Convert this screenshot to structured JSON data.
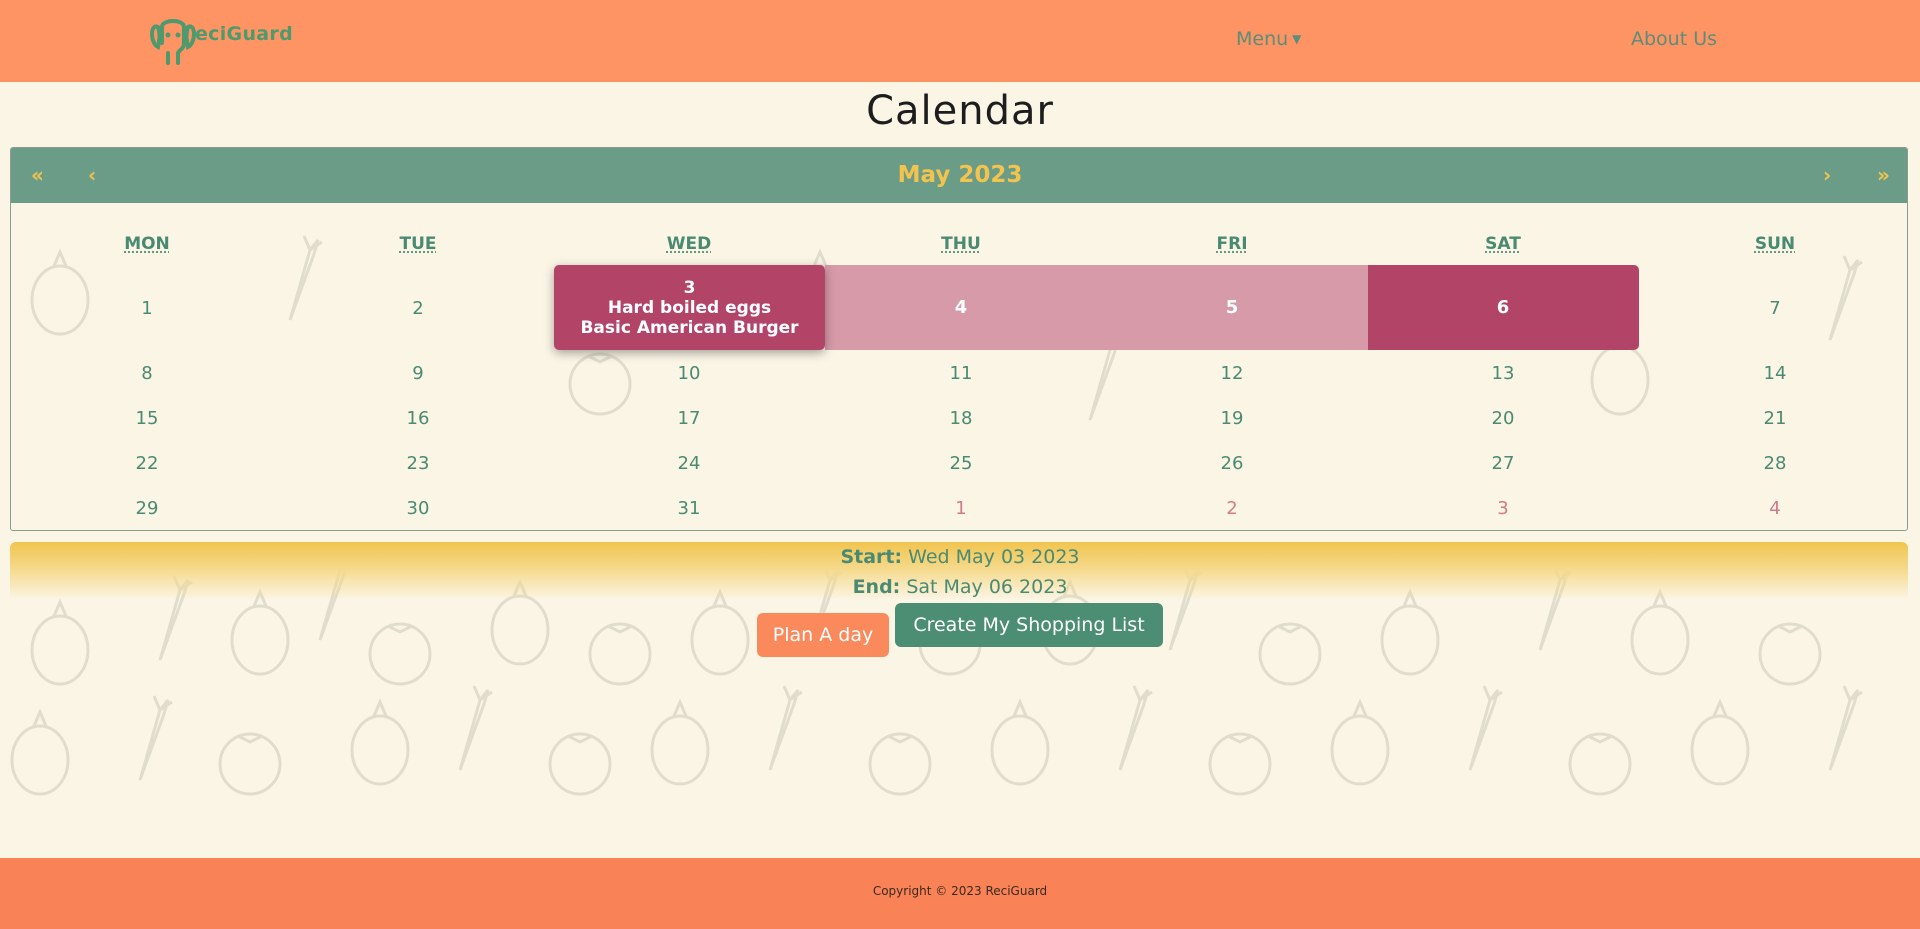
{
  "brand": {
    "name": "eciGuard",
    "logo_icon": "elephant-icon"
  },
  "nav": {
    "menu_label": "Menu",
    "about_label": "About Us"
  },
  "page": {
    "title": "Calendar"
  },
  "calendar": {
    "first_label": "«",
    "prev_label": "‹",
    "next_label": "›",
    "last_label": "»",
    "month_label": "May 2023",
    "weekdays": [
      "MON",
      "TUE",
      "WED",
      "THU",
      "FRI",
      "SAT",
      "SUN"
    ],
    "start_day": {
      "day": "3",
      "meal1": "Hard boiled eggs",
      "meal2": "Basic American Burger"
    },
    "range_days": [
      "4",
      "5",
      "6"
    ],
    "rows": [
      [
        "1",
        "2",
        "",
        "",
        "",
        "",
        "7"
      ],
      [
        "8",
        "9",
        "10",
        "11",
        "12",
        "13",
        "14"
      ],
      [
        "15",
        "16",
        "17",
        "18",
        "19",
        "20",
        "21"
      ],
      [
        "22",
        "23",
        "24",
        "25",
        "26",
        "27",
        "28"
      ],
      [
        "29",
        "30",
        "31",
        "1",
        "2",
        "3",
        "4"
      ]
    ]
  },
  "range": {
    "start_label": "Start:",
    "start_value": "Wed May 03 2023",
    "end_label": "End:",
    "end_value": "Sat May 06 2023"
  },
  "buttons": {
    "plan": "Plan A day",
    "shopping": "Create My Shopping List"
  },
  "footer": {
    "copyright": "Copyright © 2023 ReciGuard"
  },
  "colors": {
    "navbar": "#fe9364",
    "footer": "#f98256",
    "accent_green": "#4a8a72",
    "calendar_header": "#6b9c87",
    "accent_yellow": "#f2c44e",
    "selected": "#b24468",
    "in_range": "#d69aa8",
    "background": "#fbf5e6"
  }
}
